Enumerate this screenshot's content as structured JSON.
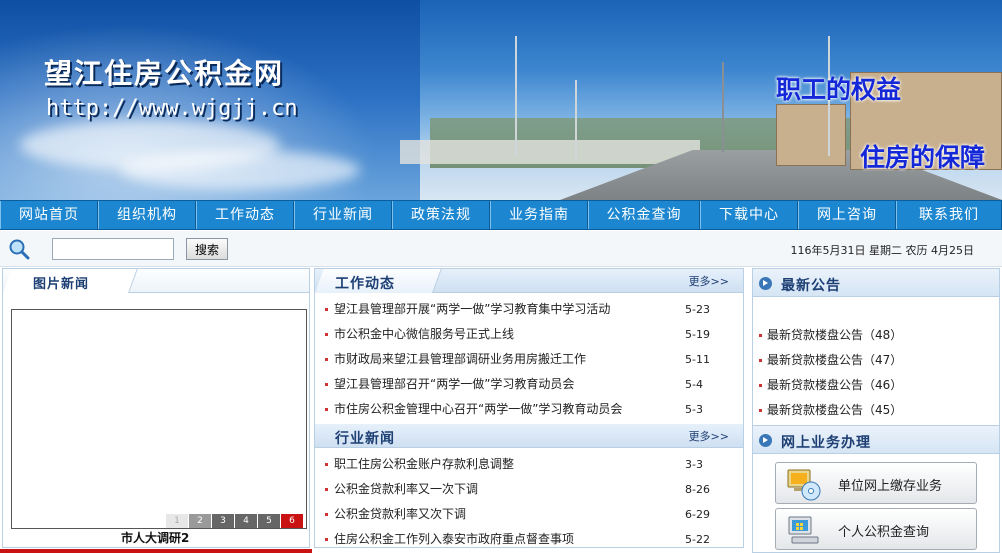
{
  "banner": {
    "site_title": "望江住房公积金网",
    "site_url": "http://www.wjgjj.cn",
    "slogan_1": "职工的权益",
    "slogan_2": "住房的保障"
  },
  "nav": {
    "items": [
      "网站首页",
      "组织机构",
      "工作动态",
      "行业新闻",
      "政策法规",
      "业务指南",
      "公积金查询",
      "下载中心",
      "网上咨询",
      "联系我们"
    ]
  },
  "search": {
    "value": "",
    "button_label": "搜索",
    "date_text": "116年5月31日 星期二 农历 4月25日"
  },
  "photo_news": {
    "title": "图片新闻",
    "pages": [
      "1",
      "2",
      "3",
      "4",
      "5",
      "6"
    ],
    "active_page": "6",
    "caption": "市人大调研2"
  },
  "work_news": {
    "title": "工作动态",
    "more": "更多>>",
    "items": [
      {
        "title": "望江县管理部开展“两学一做”学习教育集中学习活动",
        "date": "5-23"
      },
      {
        "title": "市公积金中心微信服务号正式上线",
        "date": "5-19"
      },
      {
        "title": "市财政局来望江县管理部调研业务用房搬迁工作",
        "date": "5-11"
      },
      {
        "title": "望江县管理部召开“两学一做”学习教育动员会",
        "date": "5-4"
      },
      {
        "title": "市住房公积金管理中心召开“两学一做”学习教育动员会",
        "date": "5-3"
      }
    ]
  },
  "industry_news": {
    "title": "行业新闻",
    "more": "更多>>",
    "items": [
      {
        "title": "职工住房公积金账户存款利息调整",
        "date": "3-3"
      },
      {
        "title": "公积金贷款利率又一次下调",
        "date": "8-26"
      },
      {
        "title": "公积金贷款利率又次下调",
        "date": "6-29"
      },
      {
        "title": "住房公积金工作列入泰安市政府重点督查事项",
        "date": "5-22"
      }
    ]
  },
  "notices": {
    "title": "最新公告",
    "items": [
      "最新贷款楼盘公告（48）",
      "最新贷款楼盘公告（47）",
      "最新贷款楼盘公告（46）",
      "最新贷款楼盘公告（45）"
    ]
  },
  "online_service": {
    "title": "网上业务办理",
    "buttons": [
      {
        "label": "单位网上缴存业务",
        "icon": "computer-cd-icon"
      },
      {
        "label": "个人公积金查询",
        "icon": "computer-icon"
      }
    ]
  },
  "colors": {
    "nav_bg": "#1c87d0",
    "heading": "#1d3f74",
    "accent_red": "#c91313",
    "slogan": "#1428d8"
  }
}
